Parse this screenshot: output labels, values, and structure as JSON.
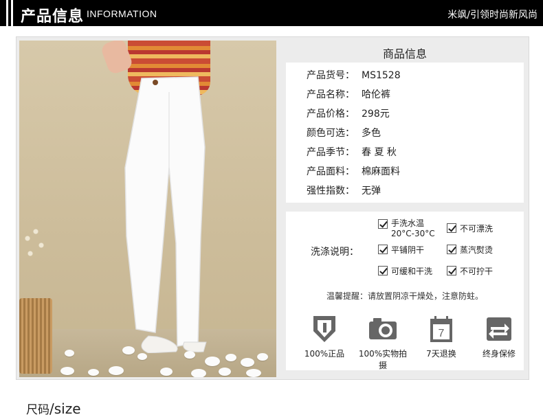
{
  "header": {
    "title": "产品信息",
    "subtitle": "INFORMATION",
    "slogan": "米飒/引领时尚新风尚"
  },
  "product_info": {
    "heading": "商品信息",
    "rows": [
      {
        "label": "产品货号：",
        "value": "MS1528"
      },
      {
        "label": "产品名称：",
        "value": "哈伦裤"
      },
      {
        "label": "产品价格：",
        "value": "298元"
      },
      {
        "label": "颜色可选：",
        "value": "多色"
      },
      {
        "label": "产品季节：",
        "value": "春 夏 秋"
      },
      {
        "label": "产品面料：",
        "value": "棉麻面料"
      },
      {
        "label": "强性指数：",
        "value": "无弹"
      }
    ]
  },
  "care": {
    "label": "洗涤说明：",
    "items": [
      {
        "text": "手洗水温",
        "text2": "20°C-30°C"
      },
      {
        "text": "不可漂洗"
      },
      {
        "text": "平铺阴干"
      },
      {
        "text": "蒸汽熨烫"
      },
      {
        "text": "可缓和干洗"
      },
      {
        "text": "不可拧干"
      }
    ],
    "tip": "温馨提醒：请放置阴凉干燥处，注意防蛀。",
    "features": [
      {
        "icon": "shield-icon",
        "label": "100%正品"
      },
      {
        "icon": "camera-icon",
        "label": "100%实物拍摄"
      },
      {
        "icon": "calendar-icon",
        "label": "7天退换",
        "number": "7"
      },
      {
        "icon": "refresh-icon",
        "label": "终身保修"
      }
    ]
  },
  "size_heading": {
    "cn": "尺码",
    "en": "/size"
  },
  "colors": {
    "header_bg": "#000000",
    "panel_bg": "#ececec",
    "icon_gray": "#666666"
  }
}
